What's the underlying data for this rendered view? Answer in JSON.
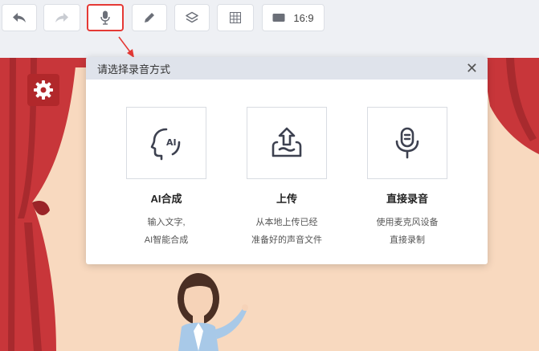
{
  "toolbar": {
    "buttons": [
      {
        "icon": "undo-icon"
      },
      {
        "icon": "redo-icon",
        "disabled": true
      },
      {
        "icon": "microphone-icon",
        "active": true
      },
      {
        "icon": "pencil-icon"
      },
      {
        "icon": "layers-icon"
      },
      {
        "icon": "grid-icon"
      }
    ],
    "ratio_label": "16:9"
  },
  "colors": {
    "highlight": "#e53935",
    "curtain": "#c8363a",
    "stage": "#f8d9bf",
    "dialog_header": "#dfe3eb"
  },
  "dialog": {
    "title": "请选择录音方式",
    "close_icon": "close-icon",
    "options": [
      {
        "icon": "ai-head-icon",
        "title": "AI合成",
        "desc_line1": "输入文字,",
        "desc_line2": "AI智能合成"
      },
      {
        "icon": "upload-icon",
        "title": "上传",
        "desc_line1": "从本地上传已经",
        "desc_line2": "准备好的声音文件"
      },
      {
        "icon": "microphone-icon",
        "title": "直接录音",
        "desc_line1": "使用麦克风设备",
        "desc_line2": "直接录制"
      }
    ]
  }
}
